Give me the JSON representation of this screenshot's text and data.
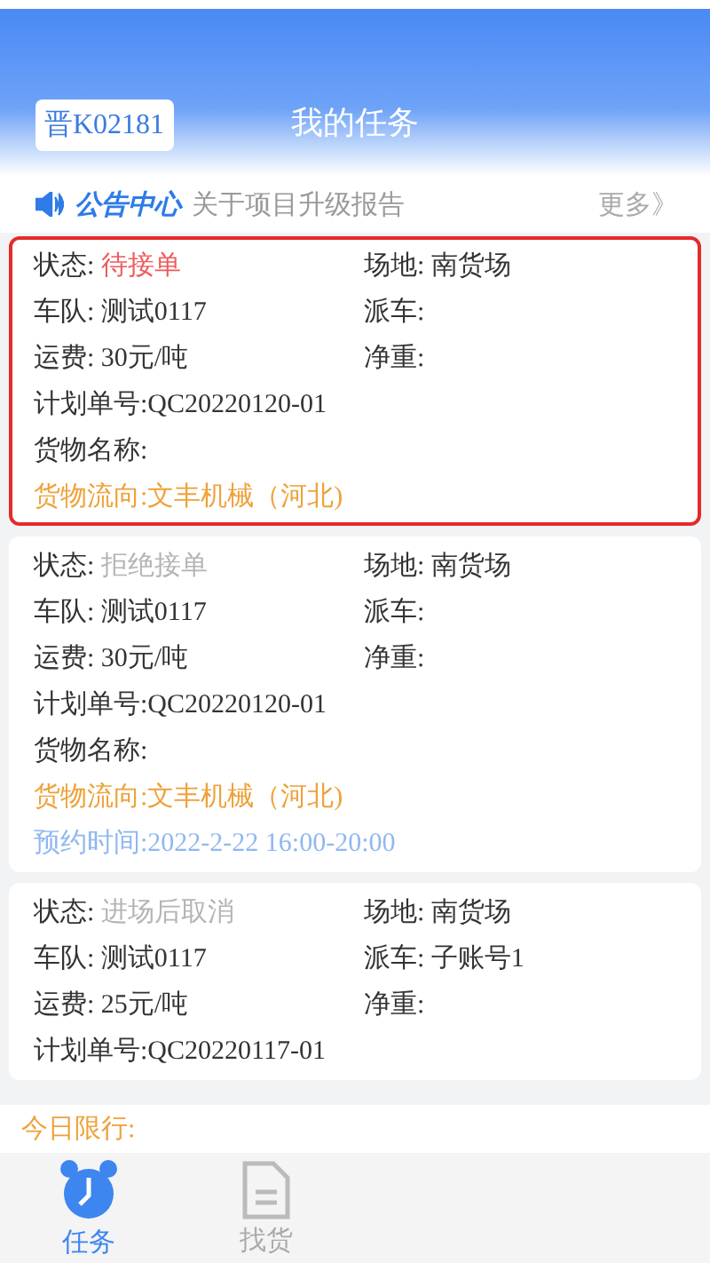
{
  "header": {
    "plate": "晋K02181",
    "title": "我的任务"
  },
  "notice": {
    "label": "公告中心",
    "text": "关于项目升级报告",
    "more": "更多》"
  },
  "tasks": [
    {
      "highlighted": true,
      "status_label": "状态:",
      "status": {
        "text": "待接单",
        "color": "#ee5b5b"
      },
      "site": "场地: 南货场",
      "fleet": "车队: 测试0117",
      "dispatch": "派车:",
      "freight": "运费: 30元/吨",
      "net_weight": "净重:",
      "plan_no": "计划单号:QC20220120-01",
      "goods_name": "货物名称:",
      "flow": "货物流向:文丰机械（河北)"
    },
    {
      "highlighted": false,
      "status_label": "状态:",
      "status": {
        "text": "拒绝接单",
        "color": "#b4b4b4"
      },
      "site": "场地: 南货场",
      "fleet": "车队: 测试0117",
      "dispatch": "派车:",
      "freight": "运费: 30元/吨",
      "net_weight": "净重:",
      "plan_no": "计划单号:QC20220120-01",
      "goods_name": "货物名称:",
      "flow": "货物流向:文丰机械（河北)",
      "appointment": "预约时间:2022-2-22 16:00-20:00"
    },
    {
      "highlighted": false,
      "status_label": "状态:",
      "status": {
        "text": "进场后取消",
        "color": "#b4b4b4"
      },
      "site": "场地: 南货场",
      "fleet": "车队: 测试0117",
      "dispatch": "派车: 子账号1",
      "freight": "运费: 25元/吨",
      "net_weight": "净重:",
      "plan_no": "计划单号:QC20220117-01"
    }
  ],
  "restriction": "今日限行:",
  "tabs": [
    {
      "label": "任务",
      "kind": "alarm",
      "selected": true
    },
    {
      "label": "找货",
      "kind": "document",
      "selected": false
    }
  ]
}
